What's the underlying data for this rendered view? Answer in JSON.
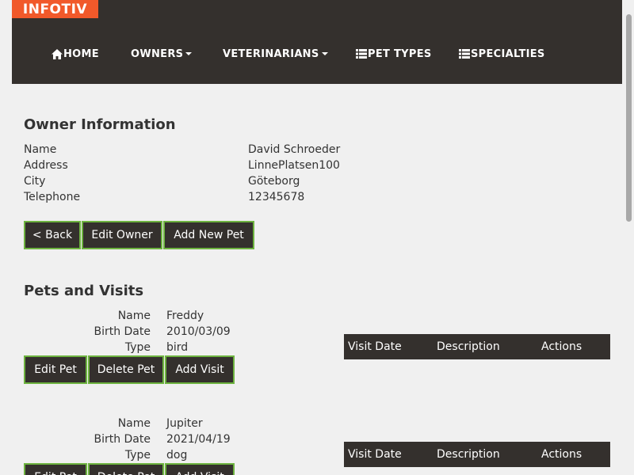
{
  "header": {
    "logo": "INFOTIV",
    "nav": [
      {
        "label": "HOME",
        "icon": "home-icon",
        "dropdown": false
      },
      {
        "label": "OWNERS",
        "icon": "",
        "dropdown": true
      },
      {
        "label": "VETERINARIANS",
        "icon": "",
        "dropdown": true
      },
      {
        "label": "PET TYPES",
        "icon": "list-icon",
        "dropdown": false
      },
      {
        "label": "SPECIALTIES",
        "icon": "list-icon",
        "dropdown": false
      }
    ]
  },
  "owner": {
    "title": "Owner Information",
    "fields": [
      {
        "label": "Name",
        "value": "David Schroeder"
      },
      {
        "label": "Address",
        "value": "LinnePlatsen100"
      },
      {
        "label": "City",
        "value": "Göteborg"
      },
      {
        "label": "Telephone",
        "value": "12345678"
      }
    ],
    "buttons": {
      "back": "< Back",
      "edit": "Edit Owner",
      "add_pet": "Add New Pet"
    }
  },
  "pets": {
    "title": "Pets and Visits",
    "labels": {
      "name": "Name",
      "birth_date": "Birth Date",
      "type": "Type"
    },
    "buttons": {
      "edit": "Edit Pet",
      "delete": "Delete Pet",
      "add_visit": "Add Visit"
    },
    "visit_headers": {
      "date": "Visit Date",
      "description": "Description",
      "actions": "Actions"
    },
    "items": [
      {
        "name": "Freddy",
        "birth_date": "2010/03/09",
        "type": "bird"
      },
      {
        "name": "Jupiter",
        "birth_date": "2021/04/19",
        "type": "dog"
      }
    ]
  },
  "colors": {
    "nav_bg": "#34302d",
    "logo_bg": "#f1592a",
    "button_border": "#6db33f",
    "page_bg": "#f0f0f0"
  }
}
